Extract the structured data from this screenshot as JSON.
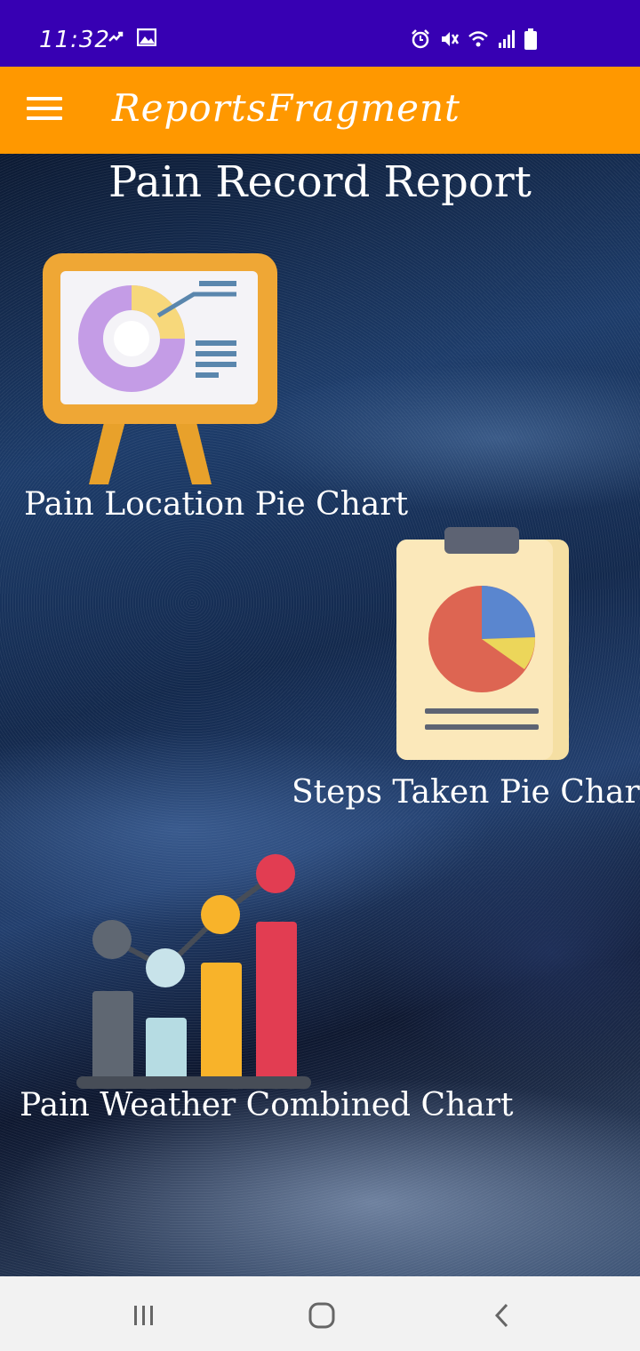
{
  "status_bar": {
    "time": "11:32",
    "left_icons": [
      "sync-icon",
      "image-icon"
    ],
    "right_icons": [
      "alarm-icon",
      "mute-icon",
      "wifi-icon",
      "signal-icon",
      "battery-icon"
    ]
  },
  "toolbar": {
    "menu_icon": "hamburger-menu-icon",
    "title": "ReportsFragment",
    "color": "#ff9800"
  },
  "main": {
    "title": "Pain Record Report",
    "reports": [
      {
        "label": "Pain Location Pie Chart",
        "icon": "presentation-pie-chart-icon"
      },
      {
        "label": "Steps Taken Pie Chart",
        "icon": "clipboard-pie-chart-icon"
      },
      {
        "label": "Pain Weather Combined Chart",
        "icon": "bar-line-chart-icon"
      }
    ]
  },
  "nav_bar": {
    "buttons": [
      "recents-icon",
      "home-icon",
      "back-icon"
    ]
  },
  "colors": {
    "status_bar": "#3700b3",
    "accent": "#ff9800"
  }
}
